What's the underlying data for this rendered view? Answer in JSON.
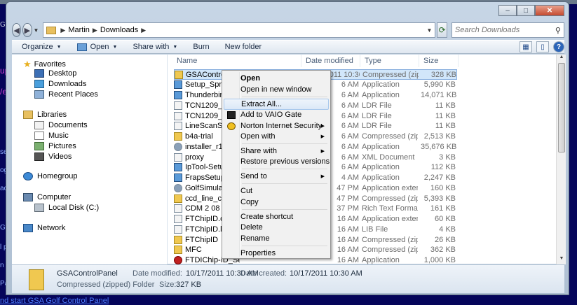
{
  "background": {
    "top_text": "Gat",
    "left_texts": [
      "up",
      "/e",
      "sell",
      "ogul",
      "ace",
      "Golf",
      "l pr",
      "n sh",
      "Pan"
    ],
    "bottom_link": "nd start GSA Golf Control Panel"
  },
  "window": {
    "controls": {
      "minimize": "–",
      "maximize": "□",
      "close": "✕"
    }
  },
  "address": {
    "breadcrumbs": [
      "Martin",
      "Downloads"
    ],
    "search_placeholder": "Search Downloads"
  },
  "toolbar": {
    "organize": "Organize",
    "open": "Open",
    "share_with": "Share with",
    "burn": "Burn",
    "new_folder": "New folder"
  },
  "nav": {
    "favorites": "Favorites",
    "desktop": "Desktop",
    "downloads": "Downloads",
    "recent_places": "Recent Places",
    "libraries": "Libraries",
    "documents": "Documents",
    "music": "Music",
    "pictures": "Pictures",
    "videos": "Videos",
    "homegroup": "Homegroup",
    "computer": "Computer",
    "local_disk": "Local Disk (C:)",
    "network": "Network"
  },
  "columns": {
    "name": "Name",
    "date": "Date modified",
    "type": "Type",
    "size": "Size"
  },
  "files": [
    {
      "name": "GSAControlPanel",
      "date": "10/17/2011 10:30 ...",
      "type": "Compressed (zipp...",
      "size": "328 KB",
      "icon": "zip"
    },
    {
      "name": "Setup_Sprint-Lay",
      "date": "6 AM",
      "type": "Application",
      "size": "5,990 KB",
      "icon": "app"
    },
    {
      "name": "Thunderbird Set",
      "date": "6 AM",
      "type": "Application",
      "size": "14,071 KB",
      "icon": "app"
    },
    {
      "name": "TCN1209_BF534_",
      "date": "6 AM",
      "type": "LDR File",
      "size": "11 KB",
      "icon": "file"
    },
    {
      "name": "TCN1209_BF534_",
      "date": "6 AM",
      "type": "LDR File",
      "size": "11 KB",
      "icon": "file"
    },
    {
      "name": "LineScanStandar",
      "date": "6 AM",
      "type": "LDR File",
      "size": "11 KB",
      "icon": "file"
    },
    {
      "name": "b4a-trial",
      "date": "6 AM",
      "type": "Compressed (zipp...",
      "size": "2,513 KB",
      "icon": "zip"
    },
    {
      "name": "installer_r12-win",
      "date": "6 AM",
      "type": "Application",
      "size": "35,676 KB",
      "icon": "gear"
    },
    {
      "name": "proxy",
      "date": "6 AM",
      "type": "XML Document",
      "size": "3 KB",
      "icon": "file"
    },
    {
      "name": "IpTool-Setup",
      "date": "6 AM",
      "type": "Application",
      "size": "112 KB",
      "icon": "app"
    },
    {
      "name": "FrapsSetup",
      "date": "4 AM",
      "type": "Application",
      "size": "2,247 KB",
      "icon": "app"
    },
    {
      "name": "GolfSimulatorsA",
      "date": "47 PM",
      "type": "Application extens...",
      "size": "160 KB",
      "icon": "gear"
    },
    {
      "name": "ccd_line_camera",
      "date": "47 PM",
      "type": "Compressed (zipp...",
      "size": "5,393 KB",
      "icon": "zip"
    },
    {
      "name": "CDM 2 08 14 Rel",
      "date": "37 PM",
      "type": "Rich Text Format",
      "size": "161 KB",
      "icon": "file"
    },
    {
      "name": "FTChipID.dll",
      "date": "16 AM",
      "type": "Application extens...",
      "size": "60 KB",
      "icon": "file"
    },
    {
      "name": "FTChipID.lib",
      "date": "16 AM",
      "type": "LIB File",
      "size": "4 KB",
      "icon": "file"
    },
    {
      "name": "FTChipID",
      "date": "16 AM",
      "type": "Compressed (zipp...",
      "size": "26 KB",
      "icon": "folder"
    },
    {
      "name": "MFC",
      "date": "16 AM",
      "type": "Compressed (zipp...",
      "size": "362 KB",
      "icon": "folder"
    },
    {
      "name": "FTDIChip-ID_Setup",
      "date": "16 AM",
      "type": "Application",
      "size": "1,000 KB",
      "icon": "red"
    }
  ],
  "context_menu": {
    "open": "Open",
    "open_new_window": "Open in new window",
    "extract_all": "Extract All...",
    "add_to_vaio": "Add to VAIO Gate",
    "norton": "Norton Internet Security",
    "open_with": "Open with",
    "share_with": "Share with",
    "restore": "Restore previous versions",
    "send_to": "Send to",
    "cut": "Cut",
    "copy": "Copy",
    "create_shortcut": "Create shortcut",
    "delete": "Delete",
    "rename": "Rename",
    "properties": "Properties"
  },
  "details": {
    "title": "GSAControlPanel",
    "type": "Compressed (zipped) Folder",
    "date_modified_label": "Date modified:",
    "date_modified": "10/17/2011 10:30 AM",
    "date_created_label": "Date created:",
    "date_created": "10/17/2011 10:30 AM",
    "size_label": "Size:",
    "size": "327 KB"
  }
}
